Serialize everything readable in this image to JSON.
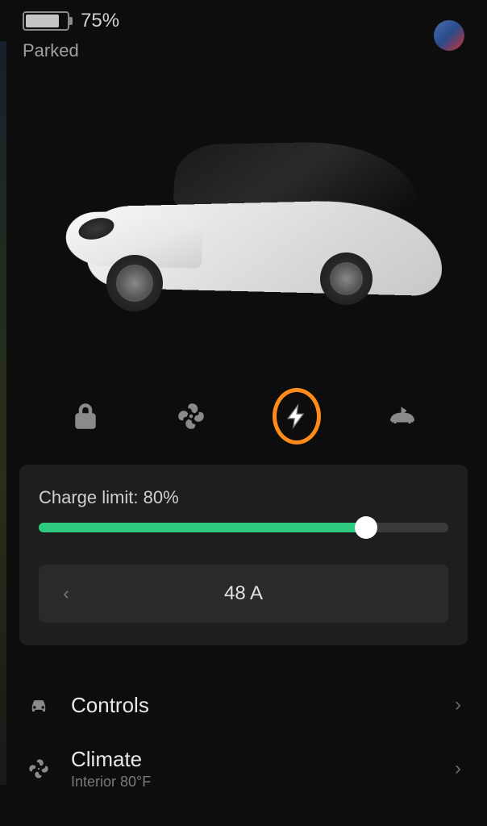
{
  "status": {
    "battery_percent": "75%",
    "vehicle_state": "Parked"
  },
  "actions": {
    "lock": "lock",
    "climate": "fan",
    "charge": "bolt",
    "frunk": "frunk"
  },
  "charge": {
    "limit_label": "Charge limit: 80%",
    "limit_percent": 80,
    "amperage": "48 A"
  },
  "menu": {
    "controls": {
      "label": "Controls"
    },
    "climate": {
      "label": "Climate",
      "sublabel": "Interior 80°F"
    }
  },
  "colors": {
    "accent_green": "#2ecb7f",
    "highlight_orange": "#ff8c1a"
  }
}
